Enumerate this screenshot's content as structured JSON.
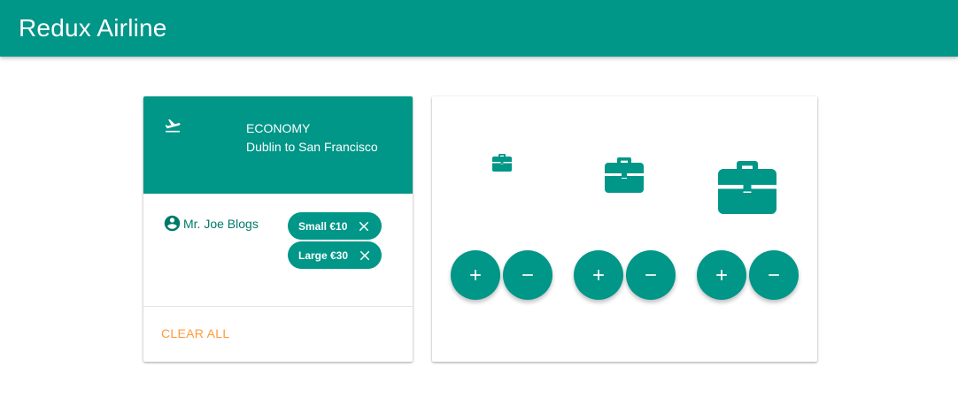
{
  "app": {
    "title": "Redux Airline"
  },
  "flight": {
    "icon": "flight-takeoff-icon",
    "class_label": "ECONOMY",
    "route": "Dublin to San Francisco"
  },
  "passenger": {
    "icon": "account-circle-icon",
    "name": "Mr. Joe Blogs"
  },
  "bags": [
    {
      "label": "Small €10",
      "icon": "close-icon"
    },
    {
      "label": "Large €30",
      "icon": "close-icon"
    }
  ],
  "actions": {
    "clear_all": "CLEAR ALL"
  },
  "luggage_options": [
    {
      "icon": "briefcase-small-icon",
      "add_icon": "plus-icon",
      "remove_icon": "minus-icon"
    },
    {
      "icon": "briefcase-medium-icon",
      "add_icon": "plus-icon",
      "remove_icon": "minus-icon"
    },
    {
      "icon": "briefcase-large-icon",
      "add_icon": "plus-icon",
      "remove_icon": "minus-icon"
    }
  ],
  "colors": {
    "primary": "#009688",
    "accent": "#ff9a3d",
    "dark_teal": "#00796b"
  }
}
